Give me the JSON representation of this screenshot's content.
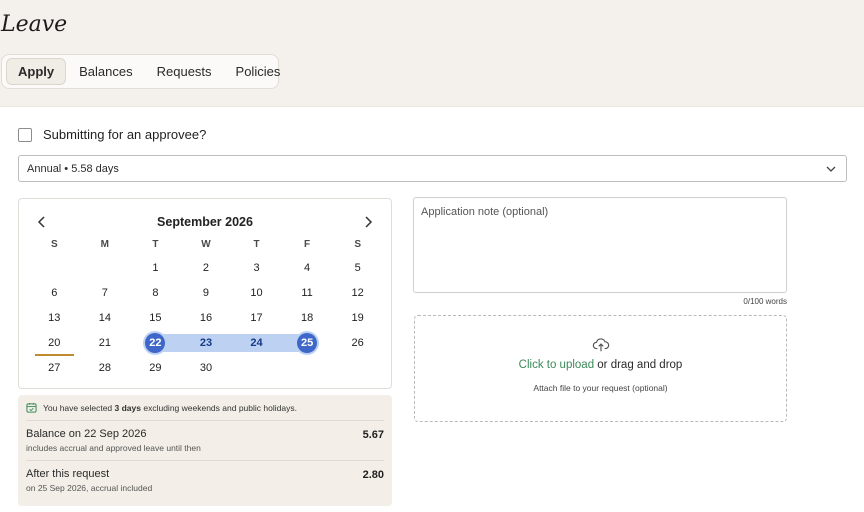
{
  "page": {
    "title": "Leave"
  },
  "tabs": [
    {
      "label": "Apply",
      "active": true
    },
    {
      "label": "Balances",
      "active": false
    },
    {
      "label": "Requests",
      "active": false
    },
    {
      "label": "Policies",
      "active": false
    }
  ],
  "form": {
    "approvee_label": "Submitting for an approvee?",
    "approvee_checked": false,
    "leave_type": "Annual • 5.58 days"
  },
  "calendar": {
    "month_label": "September 2026",
    "weekdays": [
      "S",
      "M",
      "T",
      "W",
      "T",
      "F",
      "S"
    ],
    "weeks": [
      [
        "",
        "",
        "1",
        "2",
        "3",
        "4",
        "5"
      ],
      [
        "6",
        "7",
        "8",
        "9",
        "10",
        "11",
        "12"
      ],
      [
        "13",
        "14",
        "15",
        "16",
        "17",
        "18",
        "19"
      ],
      [
        "20",
        "21",
        "22",
        "23",
        "24",
        "25",
        "26"
      ],
      [
        "27",
        "28",
        "29",
        "30",
        "",
        "",
        ""
      ]
    ],
    "today": "20",
    "range_start": "22",
    "range_end": "25",
    "range_color": "#bdd2f3",
    "selected_color": "#3e67c9",
    "today_color": "#c08a2e"
  },
  "summary": {
    "info_prefix": "You have selected ",
    "info_days": "3 days",
    "info_suffix": " excluding weekends and public holidays.",
    "balance_title": "Balance on 22 Sep 2026",
    "balance_sub": "includes accrual and approved leave until then",
    "balance_value": "5.67",
    "after_title": "After this request",
    "after_sub": "on 25 Sep 2026, accrual included",
    "after_value": "2.80"
  },
  "note": {
    "placeholder": "Application note (optional)",
    "word_count": "0/100 words"
  },
  "upload": {
    "link_text": "Click to upload",
    "rest_text": " or drag and drop",
    "sub_text": "Attach file to your request (optional)",
    "link_color": "#3b8a5a"
  },
  "icons": {
    "prev": "chevron-left-icon",
    "next": "chevron-right-icon",
    "select": "chevron-down-icon",
    "info": "calendar-icon",
    "upload": "cloud-upload-icon"
  }
}
